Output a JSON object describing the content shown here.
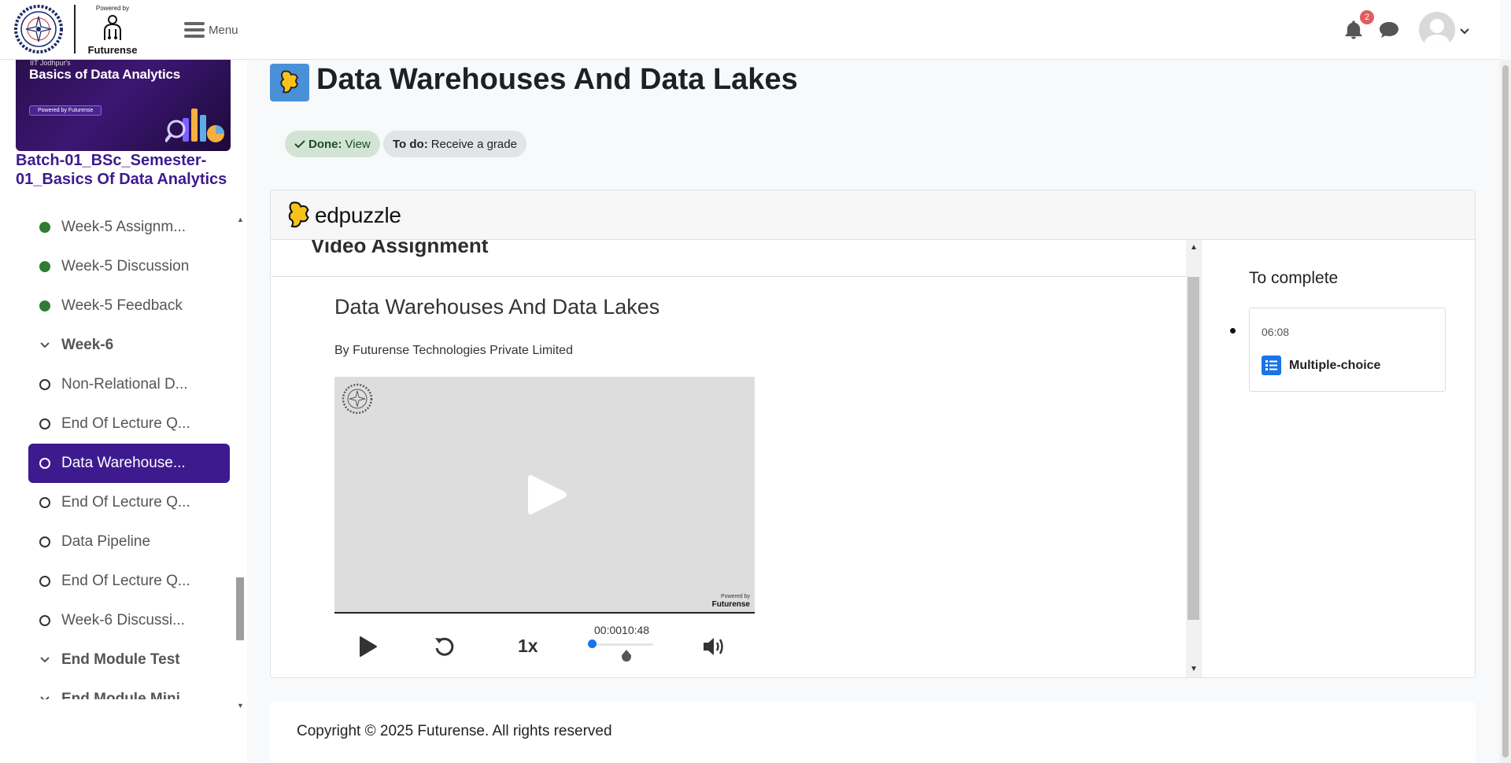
{
  "header": {
    "logo_powered_by": "Powered by",
    "logo_brand": "Futurense",
    "menu_label": "Menu",
    "notification_count": "2",
    "icons": [
      "bell-icon",
      "chat-icon",
      "avatar",
      "chevron-down-icon"
    ]
  },
  "sidebar": {
    "banner": {
      "tag": "IIT Jodhpur's",
      "title": "Basics of Data Analytics",
      "pill": "Powered by Futurense"
    },
    "course_title": "Batch-01_BSc_Semester-01_Basics Of Data Analytics",
    "items": [
      {
        "label": "Week-5 Assignm...",
        "status": "done"
      },
      {
        "label": "Week-5 Discussion",
        "status": "done"
      },
      {
        "label": "Week-5 Feedback",
        "status": "done"
      },
      {
        "label": "Week-6",
        "status": "section"
      },
      {
        "label": "Non-Relational D...",
        "status": "open"
      },
      {
        "label": "End Of Lecture Q...",
        "status": "open"
      },
      {
        "label": "Data Warehouse...",
        "status": "active"
      },
      {
        "label": "End Of Lecture Q...",
        "status": "open"
      },
      {
        "label": "Data Pipeline",
        "status": "open"
      },
      {
        "label": "End Of Lecture Q...",
        "status": "open"
      },
      {
        "label": "Week-6 Discussi...",
        "status": "open"
      },
      {
        "label": "End Module Test",
        "status": "section"
      },
      {
        "label": "End Module Mini...",
        "status": "section"
      }
    ]
  },
  "page": {
    "title": "Data Warehouses And Data Lakes",
    "done_label": "Done:",
    "done_value": "View",
    "todo_label": "To do:",
    "todo_value": "Receive a grade"
  },
  "edpuzzle": {
    "logo_text": "edpuzzle",
    "section_title": "Video Assignment",
    "video_title": "Data Warehouses And Data Lakes",
    "author": "By Futurense Technologies Private Limited",
    "player_powered_small": "Powered by",
    "player_powered_brand": "Futurense",
    "speed": "1x",
    "time_display": "00:0010:48",
    "to_complete_title": "To complete",
    "question": {
      "time": "06:08",
      "type": "Multiple-choice"
    }
  },
  "footer": {
    "copyright": "Copyright © 2025 Futurense. All rights reserved"
  },
  "colors": {
    "primary": "#3e1a8f",
    "done_green": "#2e7d32",
    "accent_blue": "#1a73e8",
    "badge_red": "#e05d5d"
  }
}
